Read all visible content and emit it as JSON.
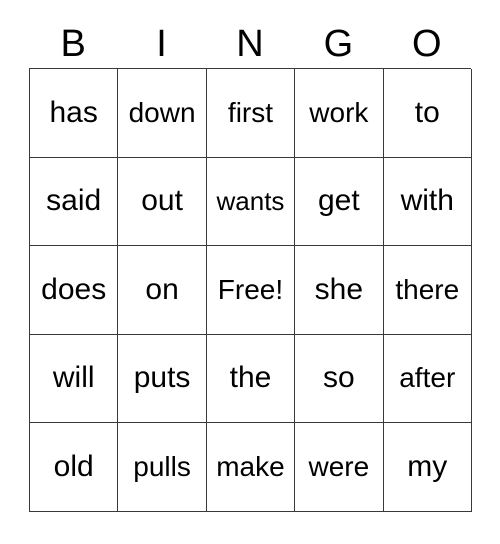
{
  "card": {
    "headers": [
      "B",
      "I",
      "N",
      "G",
      "O"
    ],
    "rows": [
      [
        "has",
        "down",
        "first",
        "work",
        "to"
      ],
      [
        "said",
        "out",
        "wants",
        "get",
        "with"
      ],
      [
        "does",
        "on",
        "Free!",
        "she",
        "there"
      ],
      [
        "will",
        "puts",
        "the",
        "so",
        "after"
      ],
      [
        "old",
        "pulls",
        "make",
        "were",
        "my"
      ]
    ],
    "free_space": "Free!",
    "colors": {
      "grid_line": "#3a3a3a",
      "text": "#000000",
      "background": "#ffffff"
    }
  }
}
